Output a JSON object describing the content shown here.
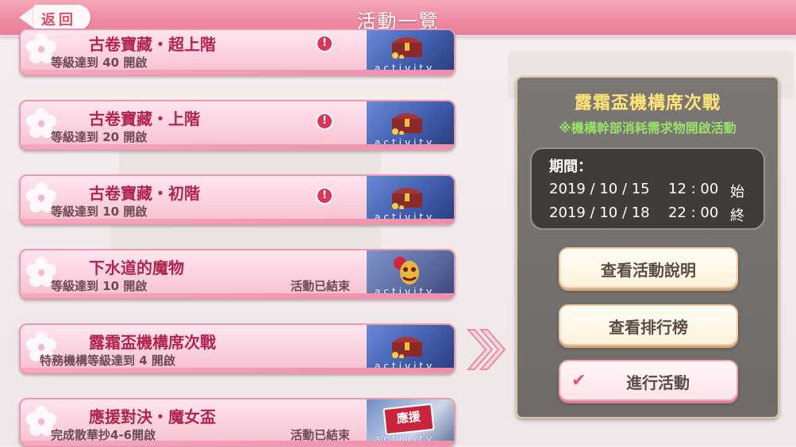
{
  "header": {
    "back_label": "返回",
    "title": "活動一覽"
  },
  "events": [
    {
      "title": "古卷寶藏・超上階",
      "requirement": "等級達到 40 開啟",
      "status": "",
      "alert": "!",
      "thumb_text": "activity"
    },
    {
      "title": "古卷寶藏・上階",
      "requirement": "等級達到 20 開啟",
      "status": "",
      "alert": "!",
      "thumb_text": "activity"
    },
    {
      "title": "古卷寶藏・初階",
      "requirement": "等級達到 10 開啟",
      "status": "",
      "alert": "!",
      "thumb_text": "activity"
    },
    {
      "title": "下水道的魔物",
      "requirement": "等級達到 10 開啟",
      "status": "活動已結束",
      "alert": "",
      "thumb_text": "activity"
    },
    {
      "title": "露霜盃機構席次戰",
      "requirement": "特務機構等級達到 4 開啟",
      "status": "",
      "alert": "",
      "thumb_text": "activity"
    },
    {
      "title": "應援對決・魔女盃",
      "requirement": "完成散華抄4-6開啟",
      "status": "活動已結束",
      "alert": "",
      "thumb_text": "activity",
      "thumb_sign": "應援"
    }
  ],
  "detail": {
    "title": "露霜盃機構席次戰",
    "note": "※機構幹部消耗需求物開啟活動",
    "period_label": "期間：",
    "start_date": "2019 / 10 / 15",
    "start_time": "12 : 00",
    "start_mark": "始",
    "end_date": "2019 / 10 / 18",
    "end_time": "22 : 00",
    "end_mark": "終",
    "btn_description": "查看活動說明",
    "btn_ranking": "查看排行榜",
    "btn_go": "進行活動",
    "check_glyph": "✔"
  },
  "colors": {
    "header": "#ee8aa1",
    "title_gold": "#ffe477",
    "note_green": "#9be26a",
    "card_title": "#b0244d"
  },
  "icons": [
    "back-arrow-icon",
    "alert-icon",
    "sakura-icon",
    "treasure-chest-icon",
    "demon-mask-icon",
    "double-chevron-right-icon",
    "check-icon"
  ]
}
